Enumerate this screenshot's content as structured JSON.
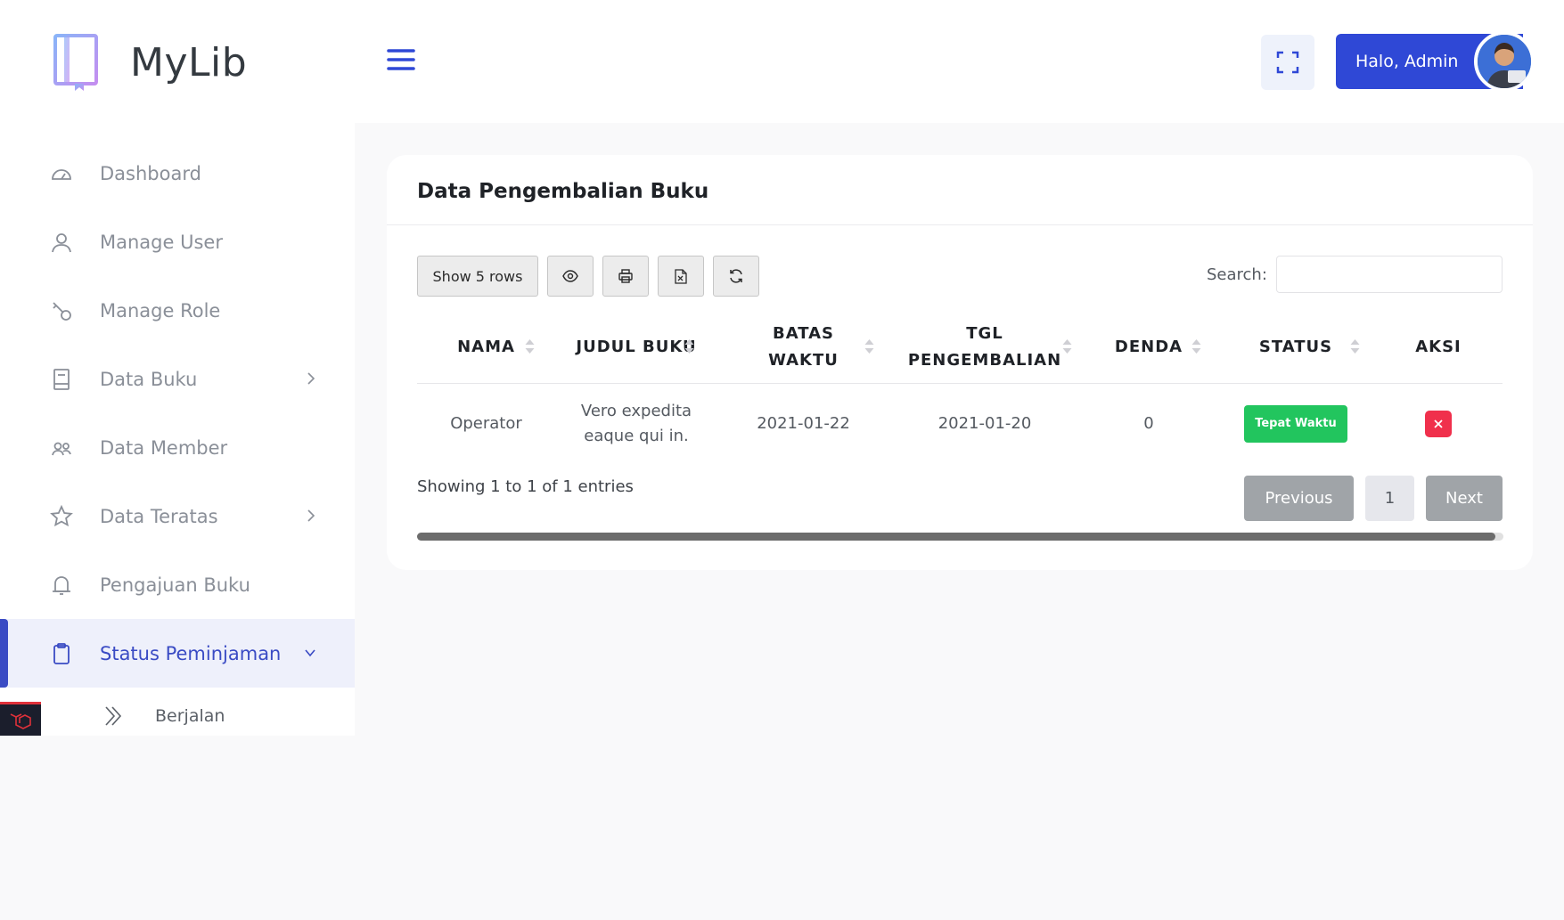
{
  "brand": {
    "name": "MyLib",
    "icon": "book-icon"
  },
  "sidebar": {
    "items": [
      {
        "label": "Dashboard",
        "icon": "gauge-icon"
      },
      {
        "label": "Manage User",
        "icon": "user-icon"
      },
      {
        "label": "Manage Role",
        "icon": "key-icon"
      },
      {
        "label": "Data Buku",
        "icon": "book-outline-icon",
        "has_children": true
      },
      {
        "label": "Data Member",
        "icon": "users-icon"
      },
      {
        "label": "Data Teratas",
        "icon": "star-icon",
        "has_children": true
      },
      {
        "label": "Pengajuan Buku",
        "icon": "bell-icon"
      },
      {
        "label": "Status Peminjaman",
        "icon": "clipboard-icon",
        "active": true,
        "expanded": true
      }
    ],
    "sub_items": [
      {
        "label": "Berjalan",
        "icon": "double-chevron-right-icon"
      }
    ]
  },
  "header": {
    "user_greeting": "Halo, Admin",
    "menu_icon": "hamburger-icon",
    "fullscreen_icon": "fullscreen-icon"
  },
  "card": {
    "title": "Data Pengembalian Buku",
    "toolbar": {
      "show_rows_label": "Show 5 rows",
      "icons": [
        "eye-icon",
        "print-icon",
        "excel-icon",
        "refresh-icon"
      ]
    },
    "search": {
      "label": "Search:",
      "value": "",
      "placeholder": ""
    },
    "table": {
      "columns": [
        {
          "line1": "NAMA",
          "line2": ""
        },
        {
          "line1": "JUDUL BUKU",
          "line2": ""
        },
        {
          "line1": "BATAS",
          "line2": "WAKTU"
        },
        {
          "line1": "TGL",
          "line2": "PENGEMBALIAN"
        },
        {
          "line1": "DENDA",
          "line2": ""
        },
        {
          "line1": "STATUS",
          "line2": ""
        },
        {
          "line1": "AKSI",
          "line2": ""
        }
      ],
      "rows": [
        {
          "nama": "Operator",
          "judul_line1": "Vero expedita",
          "judul_line2": "eaque qui in.",
          "batas_waktu": "2021-01-22",
          "tgl_pengembalian": "2021-01-20",
          "denda": "0",
          "status": "Tepat Waktu",
          "status_color": "#22c55e"
        }
      ]
    },
    "info": "Showing 1 to 1 of 1 entries",
    "pagination": {
      "previous": "Previous",
      "page": "1",
      "next": "Next"
    }
  },
  "colors": {
    "primary": "#2f48d6",
    "active_text": "#3a4bc4",
    "success": "#22c55e",
    "danger": "#f0304c"
  }
}
